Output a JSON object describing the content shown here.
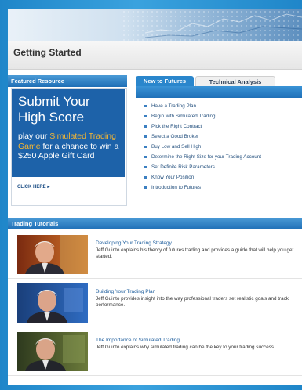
{
  "page": {
    "title": "Getting Started"
  },
  "featured": {
    "header": "Featured Resource",
    "promo_title": "Submit Your High Score",
    "promo_line1": "play our ",
    "promo_highlight": "Simulated Trading Game",
    "promo_line2": " for a chance to win a $250 Apple Gift Card",
    "cta": "CLICK HERE ▸"
  },
  "tabs": [
    {
      "label": "New to Futures",
      "active": true
    },
    {
      "label": "Technical Analysis",
      "active": false
    }
  ],
  "futures_items": [
    "Have a Trading Plan",
    "Begin with Simulated Trading",
    "Pick the Right Contract",
    "Select a Good Broker",
    "Buy Low and Sell High",
    "Determine the Right Size for your Trading Account",
    "Set Definite Risk Parameters",
    "Know Your Position",
    "Introduction to Futures"
  ],
  "tutorials": {
    "header": "Trading Tutorials",
    "items": [
      {
        "title": "Developing Your Trading Strategy",
        "description": "Jeff Guinto explains his theory of futures trading and provides a guide that will help you get started."
      },
      {
        "title": "Building Your Trading Plan",
        "description": "Jeff Guinto provides insight into the way professional traders set realistic goals and track performance."
      },
      {
        "title": "The Importance of Simulated Trading",
        "description": "Jeff Guinto explains why simulated trading can be the key to your trading success."
      }
    ]
  },
  "colors": {
    "frame_blue": "#2a8fd0",
    "promo_blue": "#1d62a9",
    "promo_highlight": "#f3b533",
    "link_blue": "#1d5d9c"
  }
}
